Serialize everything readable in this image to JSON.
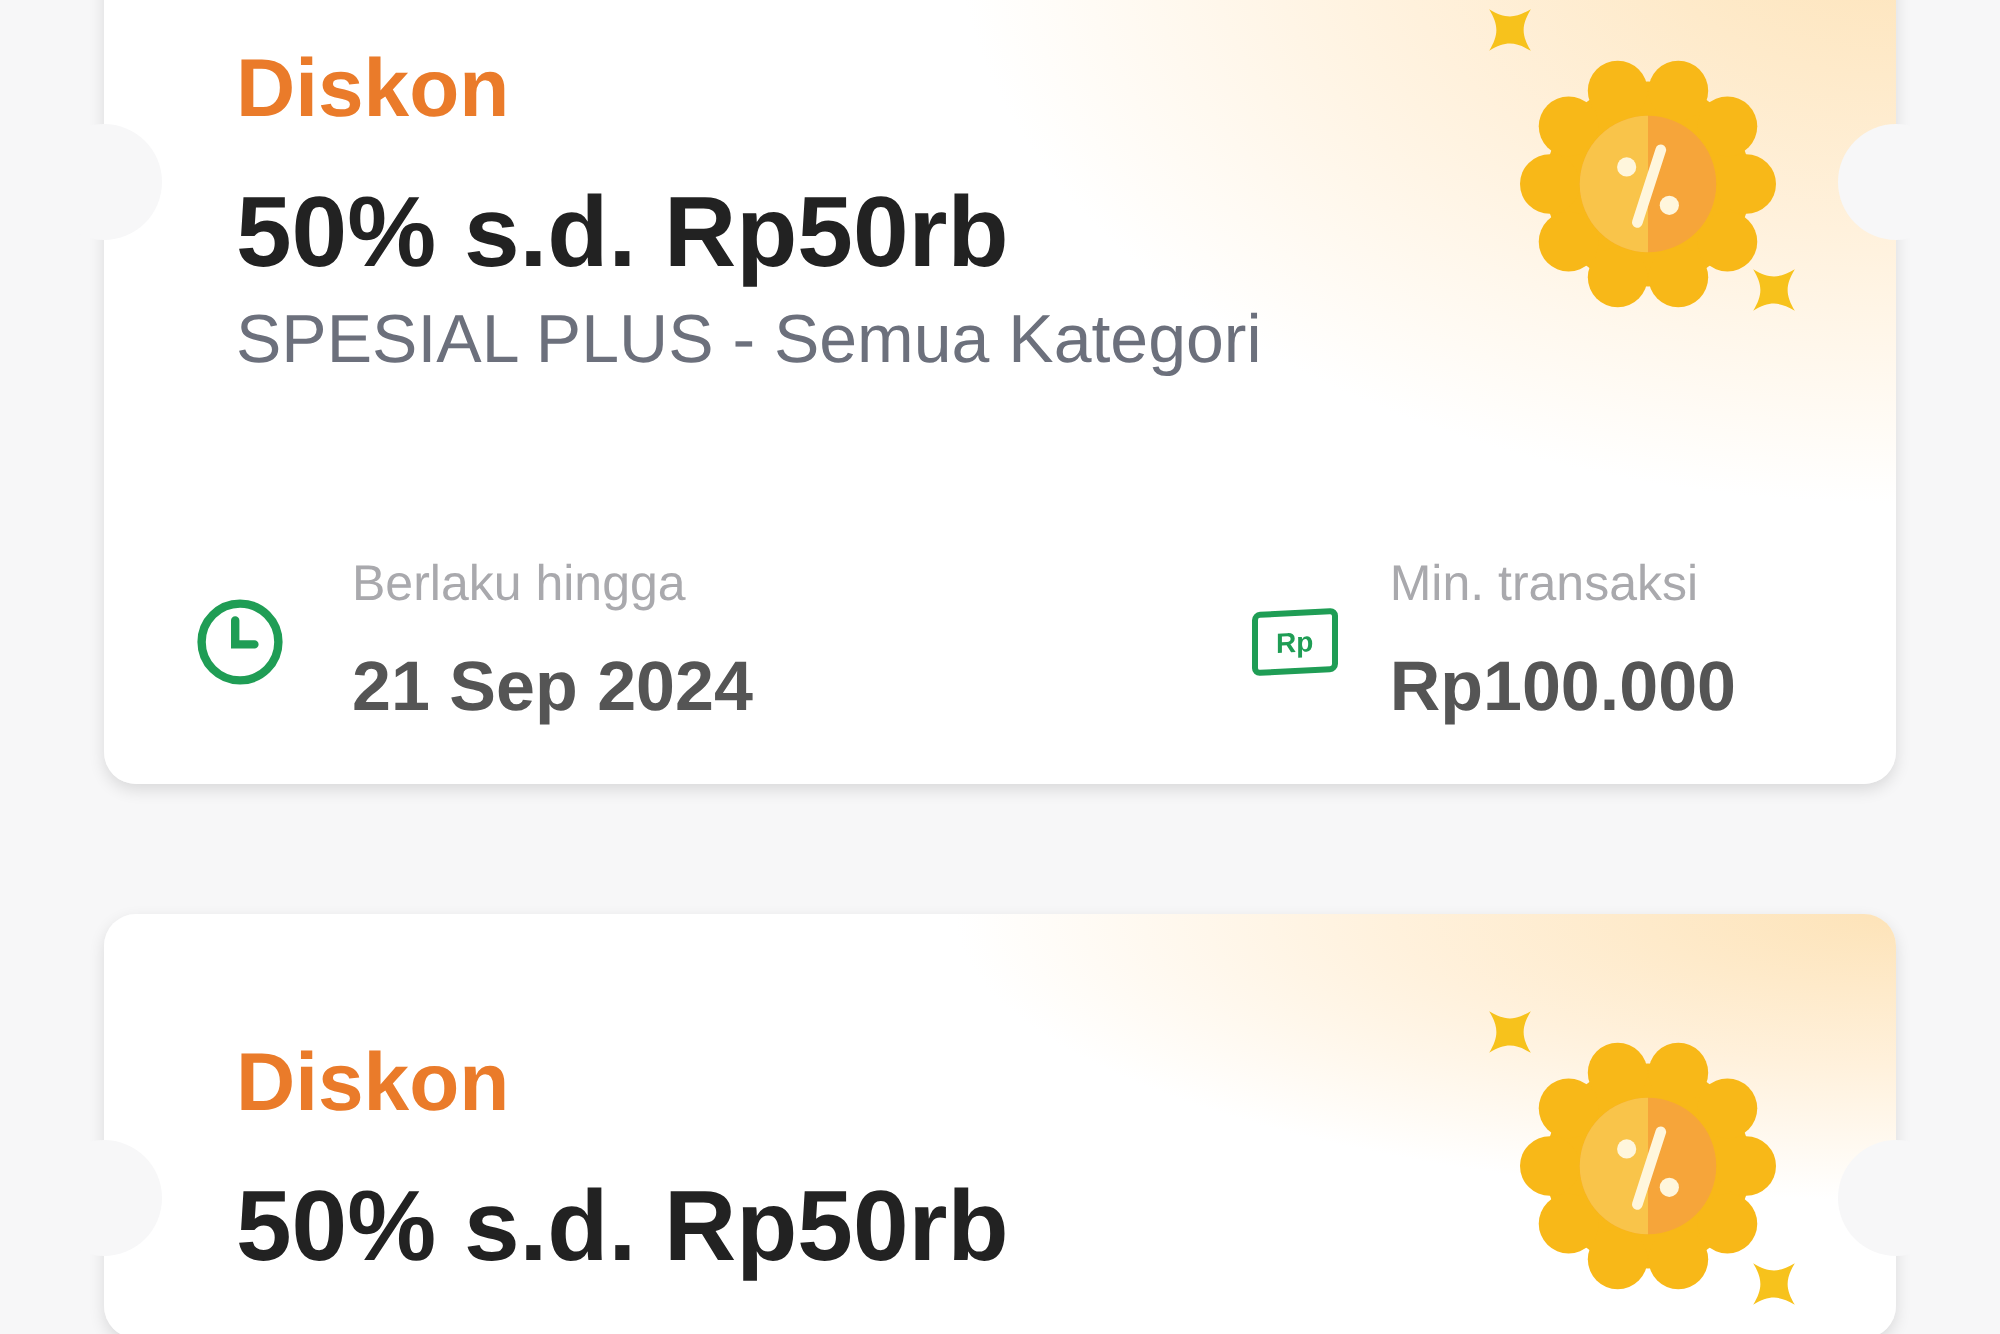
{
  "vouchers": [
    {
      "label": "Diskon",
      "title": "50% s.d. Rp50rb",
      "subtitle": "SPESIAL PLUS - Semua Kategori",
      "valid_label": "Berlaku hingga",
      "valid_date": "21 Sep 2024",
      "money_icon_text": "Rp",
      "min_label": "Min. transaksi",
      "min_value": "Rp100.000"
    },
    {
      "label": "Diskon",
      "title": "50% s.d. Rp50rb"
    }
  ]
}
